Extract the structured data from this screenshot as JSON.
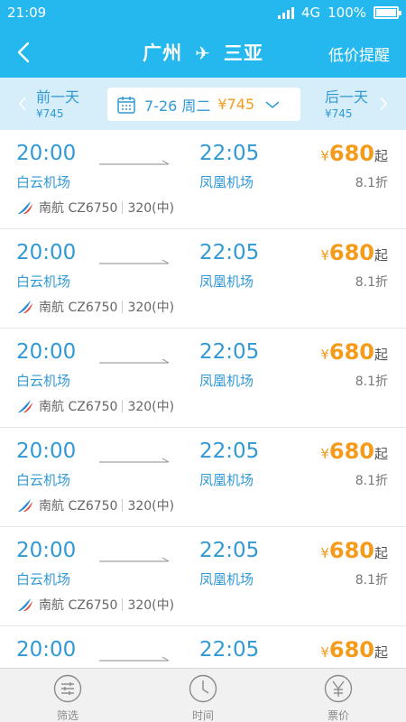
{
  "status": {
    "time": "21:09",
    "network": "4G",
    "battery": "100%",
    "battery_level": 1.0
  },
  "header": {
    "from": "广州",
    "to": "三亚",
    "alert_label": "低价提醒"
  },
  "date_bar": {
    "prev_label": "前一天",
    "prev_price": "¥745",
    "selected_date": "7-26 周二",
    "selected_price": "¥745",
    "next_label": "后一天",
    "next_price": "¥745"
  },
  "flights": [
    {
      "dep_time": "20:00",
      "dep_airport": "白云机场",
      "arr_time": "22:05",
      "arr_airport": "凤凰机场",
      "currency": "¥",
      "price": "680",
      "price_suffix": "起",
      "discount": "8.1折",
      "airline": "南航 CZ6750",
      "aircraft": "320(中)"
    },
    {
      "dep_time": "20:00",
      "dep_airport": "白云机场",
      "arr_time": "22:05",
      "arr_airport": "凤凰机场",
      "currency": "¥",
      "price": "680",
      "price_suffix": "起",
      "discount": "8.1折",
      "airline": "南航 CZ6750",
      "aircraft": "320(中)"
    },
    {
      "dep_time": "20:00",
      "dep_airport": "白云机场",
      "arr_time": "22:05",
      "arr_airport": "凤凰机场",
      "currency": "¥",
      "price": "680",
      "price_suffix": "起",
      "discount": "8.1折",
      "airline": "南航 CZ6750",
      "aircraft": "320(中)"
    },
    {
      "dep_time": "20:00",
      "dep_airport": "白云机场",
      "arr_time": "22:05",
      "arr_airport": "凤凰机场",
      "currency": "¥",
      "price": "680",
      "price_suffix": "起",
      "discount": "8.1折",
      "airline": "南航 CZ6750",
      "aircraft": "320(中)"
    },
    {
      "dep_time": "20:00",
      "dep_airport": "白云机场",
      "arr_time": "22:05",
      "arr_airport": "凤凰机场",
      "currency": "¥",
      "price": "680",
      "price_suffix": "起",
      "discount": "8.1折",
      "airline": "南航 CZ6750",
      "aircraft": "320(中)"
    },
    {
      "dep_time": "20:00",
      "dep_airport": "",
      "arr_time": "22:05",
      "arr_airport": "",
      "currency": "¥",
      "price": "680",
      "price_suffix": "起",
      "discount": "",
      "airline": "",
      "aircraft": ""
    }
  ],
  "tabs": [
    {
      "label": "筛选",
      "icon": "filter-icon"
    },
    {
      "label": "时间",
      "icon": "clock-icon"
    },
    {
      "label": "票价",
      "icon": "yen-icon"
    }
  ],
  "colors": {
    "accent": "#24b8ee",
    "link_blue": "#3199d4",
    "price_orange": "#f59b1c",
    "date_bar_bg": "#d5eefa",
    "airline_red": "#e8473c"
  }
}
